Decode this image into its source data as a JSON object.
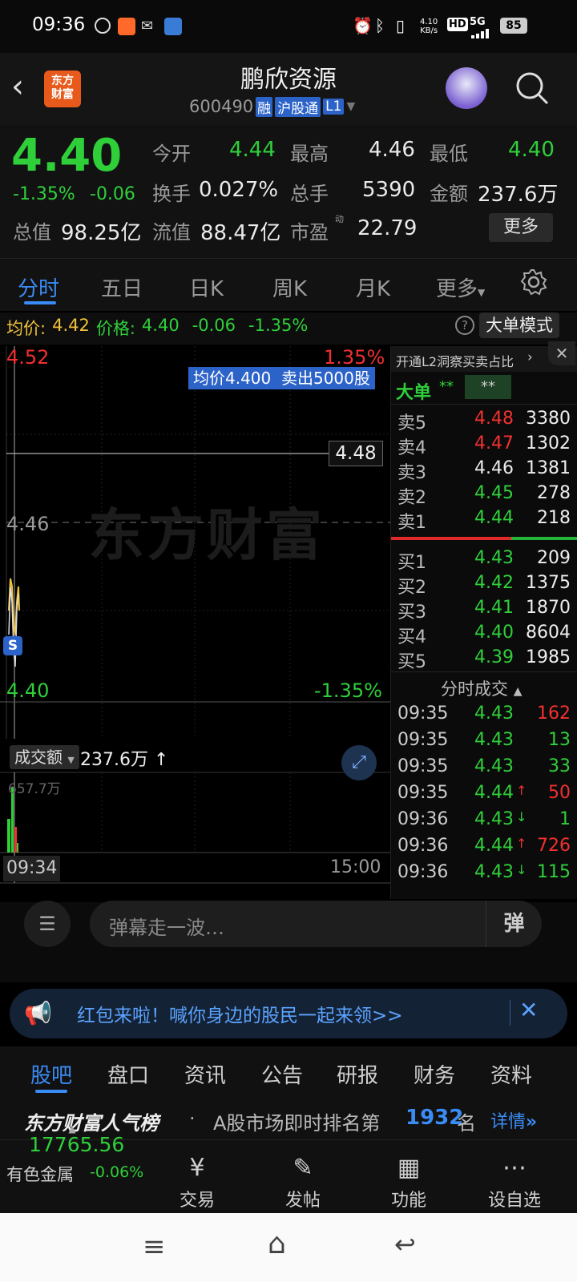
{
  "statusbar": {
    "time": "09:36",
    "network_speed": "4.10\nKB/s",
    "hd": "HD",
    "signal": "5G",
    "battery": "85"
  },
  "header": {
    "logo_text": "东方\n财富",
    "title": "鹏欣资源",
    "code": "600490",
    "badge_rong": "融",
    "badge_hgt": "沪股通",
    "badge_l1": "L1"
  },
  "quote": {
    "price": "4.40",
    "change_pct": "-1.35%",
    "change": "-0.06",
    "open_label": "今开",
    "open": "4.44",
    "high_label": "最高",
    "high": "4.46",
    "low_label": "最低",
    "low": "4.40",
    "turnover_label": "换手",
    "turnover": "0.027%",
    "volume_label": "总手",
    "volume": "5390",
    "amount_label": "金额",
    "amount": "237.6万",
    "mktcap_label": "总值",
    "mktcap": "98.25亿",
    "float_label": "流值",
    "float": "88.47亿",
    "pe_label": "市盈",
    "pe_sup": "动",
    "pe": "22.79",
    "more_button": "更多"
  },
  "tabs": {
    "items": [
      "分时",
      "五日",
      "日K",
      "周K",
      "月K",
      "更多"
    ],
    "active": 0
  },
  "strip": {
    "avg_label": "均价:",
    "avg": "4.42",
    "price_label": "价格:",
    "price": "4.40",
    "change": "-0.06",
    "pct": "-1.35%",
    "mode_button": "大单模式"
  },
  "chart": {
    "top_price": "4.52",
    "top_pct": "1.35%",
    "mid_price": "4.46",
    "bottom_price": "4.40",
    "bottom_pct": "-1.35%",
    "crosshair_price": "4.48",
    "tooltip": "均价4.400  卖出5000股",
    "watermark": "东方财富",
    "s_marker": "S"
  },
  "volume": {
    "selector": "成交额",
    "value": "237.6万",
    "arrow": "↑",
    "max_label": "657.7万",
    "time_start": "09:34",
    "time_end": "15:00"
  },
  "orderbook": {
    "promo": "开通L2洞察买卖占比",
    "big_label": "大单",
    "big_value1": "**",
    "big_value2": "**",
    "asks": [
      {
        "label": "卖5",
        "price": "4.48",
        "vol": "3380",
        "color": "#f23030"
      },
      {
        "label": "卖4",
        "price": "4.47",
        "vol": "1302",
        "color": "#f23030"
      },
      {
        "label": "卖3",
        "price": "4.46",
        "vol": "1381",
        "color": "#eaeaea"
      },
      {
        "label": "卖2",
        "price": "4.45",
        "vol": "278",
        "color": "#2fcf3a"
      },
      {
        "label": "卖1",
        "price": "4.44",
        "vol": "218",
        "color": "#2fcf3a"
      }
    ],
    "bids": [
      {
        "label": "买1",
        "price": "4.43",
        "vol": "209"
      },
      {
        "label": "买2",
        "price": "4.42",
        "vol": "1375"
      },
      {
        "label": "买3",
        "price": "4.41",
        "vol": "1870"
      },
      {
        "label": "买4",
        "price": "4.40",
        "vol": "8604"
      },
      {
        "label": "买5",
        "price": "4.39",
        "vol": "1985"
      }
    ],
    "trades_header": "分时成交",
    "trades": [
      {
        "time": "09:35",
        "price": "4.43",
        "arrow": "",
        "vol": "162",
        "volcolor": "#f23030"
      },
      {
        "time": "09:35",
        "price": "4.43",
        "arrow": "",
        "vol": "13",
        "volcolor": "#2fcf3a"
      },
      {
        "time": "09:35",
        "price": "4.43",
        "arrow": "",
        "vol": "33",
        "volcolor": "#2fcf3a"
      },
      {
        "time": "09:35",
        "price": "4.44",
        "arrow": "↑",
        "vol": "50",
        "volcolor": "#f23030"
      },
      {
        "time": "09:36",
        "price": "4.43",
        "arrow": "↓",
        "vol": "1",
        "volcolor": "#2fcf3a"
      },
      {
        "time": "09:36",
        "price": "4.44",
        "arrow": "↑",
        "vol": "726",
        "volcolor": "#f23030"
      },
      {
        "time": "09:36",
        "price": "4.43",
        "arrow": "↓",
        "vol": "115",
        "volcolor": "#2fcf3a"
      }
    ]
  },
  "danmu": {
    "placeholder": "弹幕走一波…",
    "button": "弹"
  },
  "banner": {
    "text": "红包来啦！喊你身边的股民一起来领>>"
  },
  "bottom_tabs": {
    "items": [
      "股吧",
      "盘口",
      "资讯",
      "公告",
      "研报",
      "财务",
      "资料"
    ],
    "active": 0
  },
  "rank": {
    "brand": "东方财富人气榜",
    "dot": "·",
    "text": "A股市场即时排名第",
    "rank": "1932",
    "suffix": "名",
    "detail": "详情"
  },
  "bottombar": {
    "index_value": "17765.56",
    "index_name": "有色金属",
    "index_pct": "-0.06%",
    "items": [
      "交易",
      "发帖",
      "功能",
      "设自选"
    ]
  }
}
